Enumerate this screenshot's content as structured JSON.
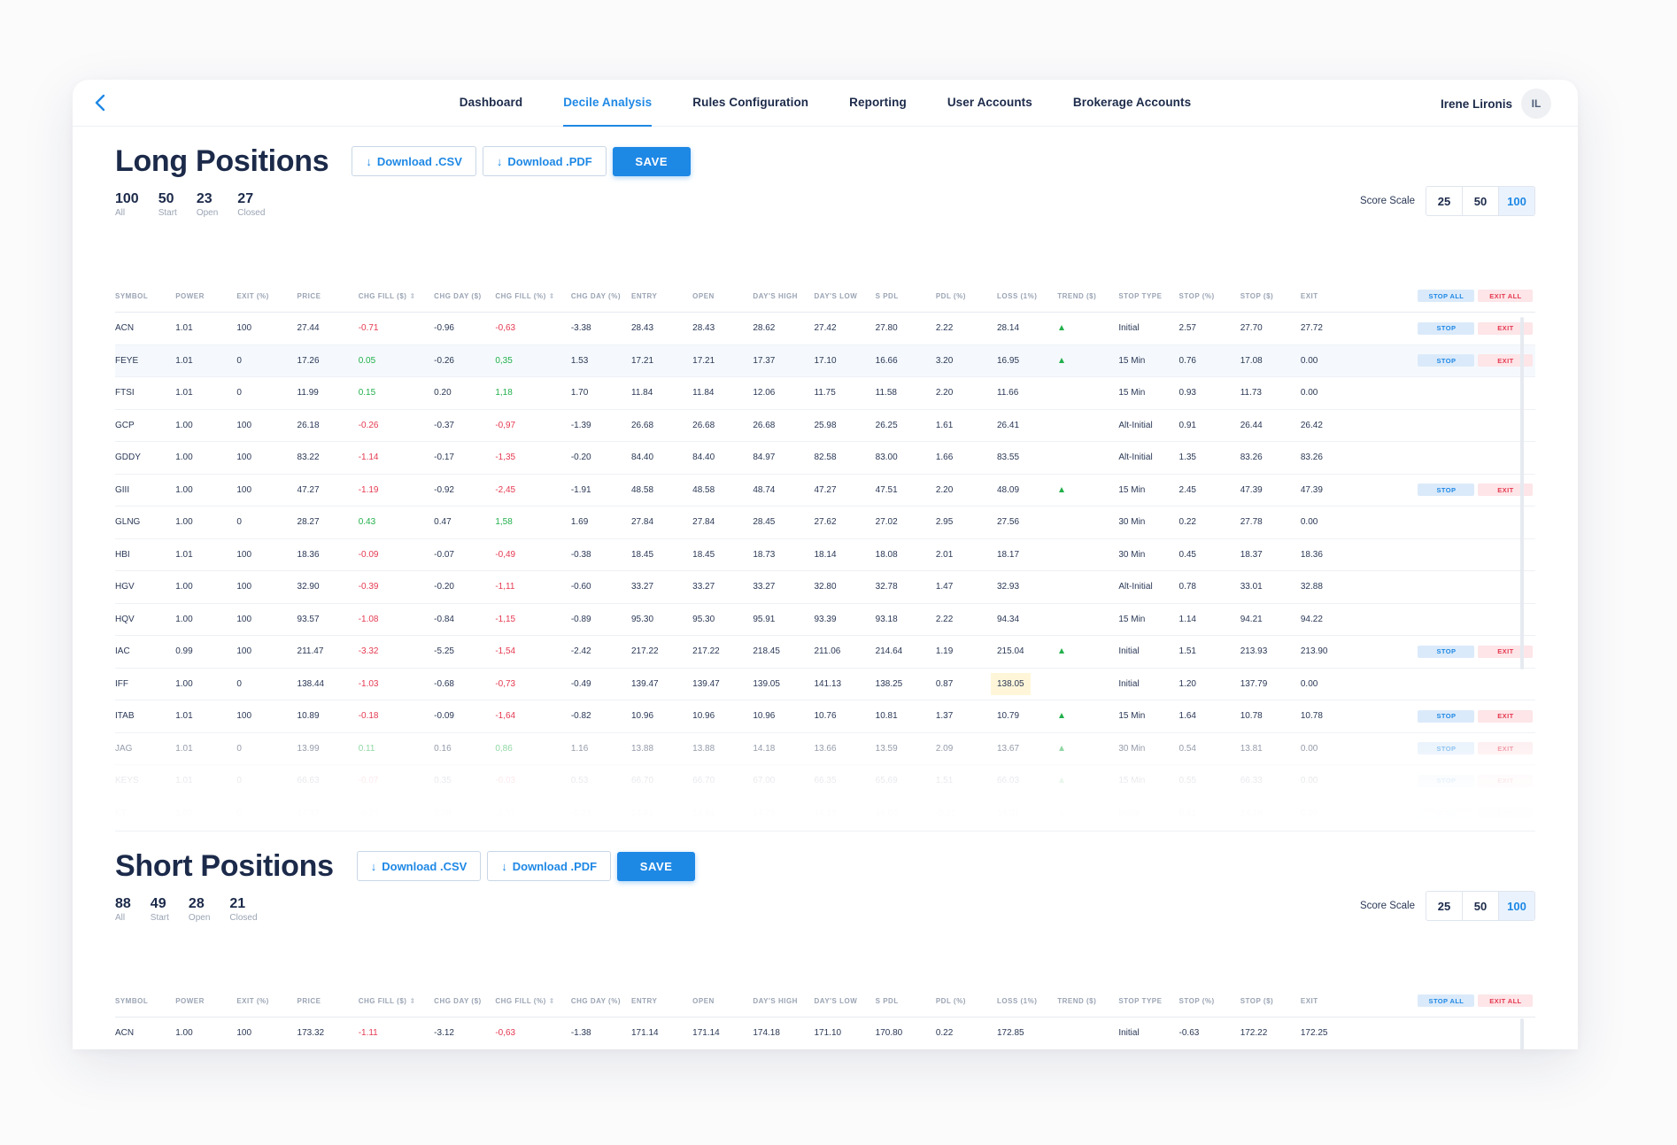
{
  "nav": {
    "items": [
      "Dashboard",
      "Decile Analysis",
      "Rules Configuration",
      "Reporting",
      "User Accounts",
      "Brokerage Accounts"
    ],
    "active": "Decile Analysis",
    "user_name": "Irene Lironis",
    "user_initials": "IL"
  },
  "colors": {
    "accent": "#1e88e5",
    "negative": "#e53950",
    "positive": "#22b04b",
    "highlight": "#fff6d9"
  },
  "icons": {
    "back": "chevron-left-icon",
    "download": "arrow-down-icon",
    "trend": "triangle-up-icon",
    "sort": "sort-icon"
  },
  "buttons": {
    "download_csv": "Download .CSV",
    "download_pdf": "Download .PDF",
    "save": "SAVE",
    "stop_all": "STOP ALL",
    "exit_all": "EXIT ALL",
    "stop": "STOP",
    "exit": "EXIT"
  },
  "score_scale": {
    "label": "Score Scale",
    "options": [
      "25",
      "50",
      "100"
    ],
    "selected": "100"
  },
  "columns": [
    "SYMBOL",
    "POWER",
    "EXIT (%)",
    "PRICE",
    "CHG FILL ($)",
    "CHG DAY ($)",
    "CHG FILL (%)",
    "CHG DAY (%)",
    "ENTRY",
    "OPEN",
    "DAY'S HIGH",
    "DAY'S LOW",
    "S PDL",
    "PDL (%)",
    "LOSS (1%)",
    "TREND ($)",
    "STOP TYPE",
    "STOP (%)",
    "STOP ($)",
    "EXIT"
  ],
  "long": {
    "title": "Long Positions",
    "stats": [
      {
        "num": "100",
        "label": "All"
      },
      {
        "num": "50",
        "label": "Start"
      },
      {
        "num": "23",
        "label": "Open"
      },
      {
        "num": "27",
        "label": "Closed"
      }
    ],
    "rows": [
      {
        "cells": [
          "ACN",
          "1.01",
          "100",
          "27.44",
          "-0.71",
          "-0.96",
          "-0,63",
          "-3.38",
          "28.43",
          "28.43",
          "28.62",
          "27.42",
          "27.80",
          "2.22",
          "28.14",
          "",
          "Initial",
          "2.57",
          "27.70",
          "27.72"
        ],
        "fill": "neg",
        "trend": true,
        "actions": true
      },
      {
        "cells": [
          "FEYE",
          "1.01",
          "0",
          "17.26",
          "0.05",
          "-0.26",
          "0,35",
          "1.53",
          "17.21",
          "17.21",
          "17.37",
          "17.10",
          "16.66",
          "3.20",
          "16.95",
          "",
          "15 Min",
          "0.76",
          "17.08",
          "0.00"
        ],
        "fill": "pos",
        "trend": true,
        "actions": true,
        "hl": true
      },
      {
        "cells": [
          "FTSI",
          "1.01",
          "0",
          "11.99",
          "0.15",
          "0.20",
          "1,18",
          "1.70",
          "11.84",
          "11.84",
          "12.06",
          "11.75",
          "11.58",
          "2.20",
          "11.66",
          "",
          "15 Min",
          "0.93",
          "11.73",
          "0.00"
        ],
        "fill": "pos",
        "trend": false,
        "actions": false
      },
      {
        "cells": [
          "GCP",
          "1.00",
          "100",
          "26.18",
          "-0.26",
          "-0.37",
          "-0,97",
          "-1.39",
          "26.68",
          "26.68",
          "26.68",
          "25.98",
          "26.25",
          "1.61",
          "26.41",
          "",
          "Alt-Initial",
          "0.91",
          "26.44",
          "26.42"
        ],
        "fill": "neg",
        "trend": false,
        "actions": false
      },
      {
        "cells": [
          "GDDY",
          "1.00",
          "100",
          "83.22",
          "-1.14",
          "-0.17",
          "-1,35",
          "-0.20",
          "84.40",
          "84.40",
          "84.97",
          "82.58",
          "83.00",
          "1.66",
          "83.55",
          "",
          "Alt-Initial",
          "1.35",
          "83.26",
          "83.26"
        ],
        "fill": "neg",
        "trend": false,
        "actions": false
      },
      {
        "cells": [
          "GIII",
          "1.00",
          "100",
          "47.27",
          "-1.19",
          "-0.92",
          "-2,45",
          "-1.91",
          "48.58",
          "48.58",
          "48.74",
          "47.27",
          "47.51",
          "2.20",
          "48.09",
          "",
          "15 Min",
          "2.45",
          "47.39",
          "47.39"
        ],
        "fill": "neg",
        "trend": true,
        "actions": true
      },
      {
        "cells": [
          "GLNG",
          "1.00",
          "0",
          "28.27",
          "0.43",
          "0.47",
          "1,58",
          "1.69",
          "27.84",
          "27.84",
          "28.45",
          "27.62",
          "27.02",
          "2.95",
          "27.56",
          "",
          "30 Min",
          "0.22",
          "27.78",
          "0.00"
        ],
        "fill": "pos",
        "trend": false,
        "actions": false
      },
      {
        "cells": [
          "HBI",
          "1.01",
          "100",
          "18.36",
          "-0.09",
          "-0.07",
          "-0,49",
          "-0.38",
          "18.45",
          "18.45",
          "18.73",
          "18.14",
          "18.08",
          "2.01",
          "18.17",
          "",
          "30 Min",
          "0.45",
          "18.37",
          "18.36"
        ],
        "fill": "neg",
        "trend": false,
        "actions": false
      },
      {
        "cells": [
          "HGV",
          "1.00",
          "100",
          "32.90",
          "-0.39",
          "-0.20",
          "-1,11",
          "-0.60",
          "33.27",
          "33.27",
          "33.27",
          "32.80",
          "32.78",
          "1.47",
          "32.93",
          "",
          "Alt-Initial",
          "0.78",
          "33.01",
          "32.88"
        ],
        "fill": "neg",
        "trend": false,
        "actions": false
      },
      {
        "cells": [
          "HQV",
          "1.00",
          "100",
          "93.57",
          "-1.08",
          "-0.84",
          "-1,15",
          "-0.89",
          "95.30",
          "95.30",
          "95.91",
          "93.39",
          "93.18",
          "2.22",
          "94.34",
          "",
          "15 Min",
          "1.14",
          "94.21",
          "94.22"
        ],
        "fill": "neg",
        "trend": false,
        "actions": false
      },
      {
        "cells": [
          "IAC",
          "0.99",
          "100",
          "211.47",
          "-3.32",
          "-5.25",
          "-1,54",
          "-2.42",
          "217.22",
          "217.22",
          "218.45",
          "211.06",
          "214.64",
          "1.19",
          "215.04",
          "",
          "Initial",
          "1.51",
          "213.93",
          "213.90"
        ],
        "fill": "neg",
        "trend": true,
        "actions": true
      },
      {
        "cells": [
          "IFF",
          "1.00",
          "0",
          "138.44",
          "-1.03",
          "-0.68",
          "-0,73",
          "-0.49",
          "139.47",
          "139.47",
          "139.05",
          "141.13",
          "138.25",
          "0.87",
          "138.05",
          "",
          "Initial",
          "1.20",
          "137.79",
          "0.00"
        ],
        "fill": "neg",
        "trend": false,
        "actions": false,
        "loss_hl": true
      },
      {
        "cells": [
          "ITAB",
          "1.01",
          "100",
          "10.89",
          "-0.18",
          "-0.09",
          "-1,64",
          "-0.82",
          "10.96",
          "10.96",
          "10.96",
          "10.76",
          "10.81",
          "1.37",
          "10.79",
          "",
          "15 Min",
          "1.64",
          "10.78",
          "10.78"
        ],
        "fill": "neg",
        "trend": true,
        "actions": true
      },
      {
        "cells": [
          "JAG",
          "1.01",
          "0",
          "13.99",
          "0.11",
          "0.16",
          "0,86",
          "1.16",
          "13.88",
          "13.88",
          "14.18",
          "13.66",
          "13.59",
          "2.09",
          "13.67",
          "",
          "30 Min",
          "0.54",
          "13.81",
          "0.00"
        ],
        "fill": "pos",
        "trend": true,
        "actions": true
      },
      {
        "cells": [
          "KEYS",
          "1.01",
          "0",
          "66.63",
          "-0.07",
          "0.35",
          "-0.03",
          "0.53",
          "66.70",
          "66.70",
          "67.00",
          "66.35",
          "65.69",
          "1.51",
          "66.03",
          "",
          "15 Min",
          "0.55",
          "66.33",
          "0.00"
        ],
        "fill": "neg",
        "trend": true,
        "actions": true
      },
      {
        "cells": [
          "KT",
          "1.00",
          "0",
          "14.37",
          "-0.24",
          "0.08",
          "-1.57",
          "-0.23",
          "14.61",
          "14.61",
          "14.75",
          "14.18",
          "14.04",
          "-0.21",
          "14.01",
          "",
          "Initial",
          "0.61",
          "14.18",
          "0.00"
        ],
        "fill": "neg",
        "trend": true,
        "actions": true
      }
    ]
  },
  "short": {
    "title": "Short Positions",
    "stats": [
      {
        "num": "88",
        "label": "All"
      },
      {
        "num": "49",
        "label": "Start"
      },
      {
        "num": "28",
        "label": "Open"
      },
      {
        "num": "21",
        "label": "Closed"
      }
    ],
    "rows": [
      {
        "cells": [
          "ACN",
          "1.00",
          "100",
          "173.32",
          "-1.11",
          "-3.12",
          "-0,63",
          "-1.38",
          "171.14",
          "171.14",
          "174.18",
          "171.10",
          "170.80",
          "0.22",
          "172.85",
          "",
          "Initial",
          "-0.63",
          "172.22",
          "172.25"
        ],
        "fill": "neg",
        "trend": false,
        "actions": false
      }
    ]
  }
}
